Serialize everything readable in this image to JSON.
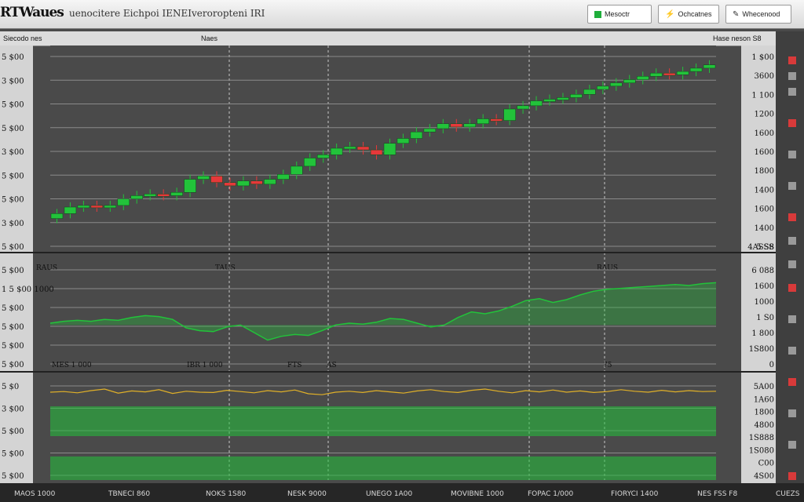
{
  "app": {
    "logo": "RTWaues",
    "subtitle": "uenocitere Eichpoi IENEIveroropteni IRI",
    "buttons": [
      {
        "label": "Mesoctr",
        "icon": "green-square-icon"
      },
      {
        "label": "Ochcatnes",
        "icon": "bolt-icon"
      },
      {
        "label": "Whecenood",
        "icon": "pencil-icon"
      }
    ]
  },
  "header": {
    "left": "Siecodo nes",
    "center": "Naes",
    "right": "Hase neson S8"
  },
  "footer": {
    "labels": [
      "MAOS 1000",
      "TBNECI 860",
      "NOKS 1S80",
      "NESK 9000",
      "UNEGO 1A00",
      "MOVIBNE 1000",
      "FOPAC 1/000",
      "FIORYCI 1400",
      "NES FSS F8",
      "CUEZS"
    ]
  },
  "colors": {
    "up": "#22c33a",
    "down": "#e6383a",
    "panel": "#4a4a4a",
    "grid": "#8a8a8a",
    "gutter": "#d4d4d4"
  },
  "chart_data": [
    {
      "type": "candlestick",
      "panel": "price",
      "left_ticks": [
        "5 $00",
        "3 $00",
        "5 $00",
        "5 $00",
        "3 $00",
        "5 $00",
        "5 $00",
        "3 $00",
        "5 $00"
      ],
      "right_ticks": [
        "1 $00",
        "3600",
        "1 100",
        "1200",
        "1600",
        "1600",
        "1800",
        "1400",
        "1600",
        "1400",
        "5 S8"
      ],
      "right_sublabel": "4ASSS",
      "bottom_markers": [
        "RAUS",
        "TAUS",
        "RAUS"
      ],
      "close": [
        40,
        44,
        45,
        44,
        45,
        49,
        51,
        52,
        51,
        53,
        61,
        63,
        59,
        57,
        60,
        58,
        61,
        64,
        69,
        74,
        76,
        80,
        81,
        79,
        76,
        83,
        86,
        90,
        92,
        95,
        93,
        95,
        98,
        97,
        104,
        106,
        109,
        110,
        111,
        113,
        116,
        118,
        120,
        122,
        124,
        126,
        125,
        127,
        129,
        131
      ],
      "open": [
        37,
        40,
        44,
        45,
        44,
        45,
        49,
        51,
        52,
        51,
        53,
        61,
        63,
        59,
        57,
        60,
        58,
        61,
        64,
        69,
        74,
        76,
        80,
        81,
        79,
        76,
        83,
        86,
        90,
        92,
        95,
        93,
        95,
        98,
        97,
        104,
        106,
        109,
        110,
        111,
        113,
        116,
        118,
        120,
        122,
        124,
        126,
        125,
        127,
        129
      ],
      "ylim": [
        20,
        140
      ]
    },
    {
      "type": "line",
      "panel": "indicator",
      "left_ticks": [
        "5 $00",
        "1 5 $00 1000",
        "5 $00",
        "5 $00",
        "5 $00",
        "5 $00"
      ],
      "right_ticks": [
        "6 088",
        "1600",
        "1000",
        "1 S0",
        "1 800",
        "1S800",
        "0"
      ],
      "bottom_markers": [
        "MES 1 000",
        "IBR 1 000",
        "FTS",
        "AS",
        "75"
      ],
      "values": [
        60,
        62,
        63,
        62,
        64,
        63,
        66,
        68,
        67,
        64,
        55,
        52,
        51,
        56,
        58,
        50,
        42,
        46,
        48,
        47,
        52,
        58,
        60,
        59,
        61,
        65,
        64,
        60,
        56,
        58,
        66,
        72,
        70,
        73,
        78,
        84,
        86,
        82,
        85,
        90,
        94,
        96,
        97,
        98,
        99,
        100,
        101,
        100,
        102,
        103
      ],
      "ylim": [
        20,
        120
      ]
    },
    {
      "type": "line",
      "panel": "oscillator",
      "left_ticks": [
        "5 $0",
        "3 $00",
        "5 $00",
        "5 $00",
        "5 $00"
      ],
      "right_ticks": [
        "5A00",
        "1A60",
        "1800",
        "4800",
        "1S888",
        "1S080",
        "C00",
        "4S00"
      ],
      "values": [
        50,
        52,
        48,
        55,
        60,
        47,
        54,
        51,
        58,
        46,
        53,
        50,
        49,
        56,
        52,
        48,
        55,
        51,
        57,
        45,
        42,
        50,
        53,
        49,
        55,
        51,
        47,
        54,
        58,
        52,
        49,
        56,
        60,
        53,
        48,
        55,
        51,
        57,
        50,
        54,
        49,
        52,
        58,
        53,
        50,
        56,
        51,
        55,
        52,
        53
      ],
      "ylim": [
        0,
        100
      ]
    }
  ]
}
